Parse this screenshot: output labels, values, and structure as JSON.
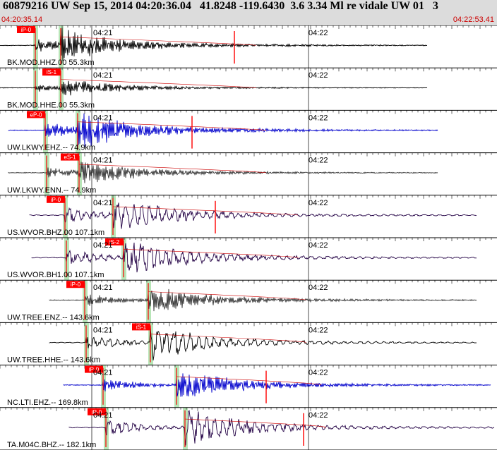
{
  "header": {
    "title": "60879216 UW Sep 15, 2014 04:20:36.04   41.8248 -119.6430  3.6 3.34 Ml re vidale UW 01   3",
    "start_time": "04:20:35.14",
    "end_time": "04:22:53.41"
  },
  "colors": {
    "header_bg": "#dcdcdc",
    "pick": "#ff0000",
    "phase_window": "#b8e6b8"
  },
  "ticks": [
    "04:21",
    "04:22"
  ],
  "traces": [
    {
      "label": "BK.MOD.HHZ.00 55.3km",
      "color": "#000000",
      "pick_label": "iP-0",
      "s_label": "",
      "end_label": ""
    },
    {
      "label": "BK.MOD.HHE.00 55.3km",
      "color": "#000000",
      "pick_label": "",
      "s_label": "iS-1",
      "end_label": ""
    },
    {
      "label": "UW.LKWY.EHZ.-- 74.9km",
      "color": "#0000cc",
      "pick_label": "eP-0",
      "s_label": "",
      "end_label": ""
    },
    {
      "label": "UW.LKWY.ENN.-- 74.9km",
      "color": "#333333",
      "pick_label": "",
      "s_label": "eS-1",
      "end_label": ""
    },
    {
      "label": "US.WVOR.BHZ.00 107.1km",
      "color": "#220044",
      "pick_label": "iP-0",
      "s_label": "",
      "end_label": ""
    },
    {
      "label": "US.WVOR.BH1.00 107.1km",
      "color": "#220044",
      "pick_label": "",
      "s_label": "iS-2",
      "end_label": ""
    },
    {
      "label": "UW.TREE.ENZ.-- 143.6km",
      "color": "#333333",
      "pick_label": "iP-0",
      "s_label": "",
      "end_label": ""
    },
    {
      "label": "UW.TREE.HHE.-- 143.6km",
      "color": "#000000",
      "pick_label": "",
      "s_label": "iS-1",
      "end_label": ""
    },
    {
      "label": "NC.LTI.EHZ.-- 169.8km",
      "color": "#0000cc",
      "pick_label": "iP-0",
      "s_label": "",
      "end_label": ""
    },
    {
      "label": "TA.M04C.BHZ.-- 182.1km",
      "color": "#220044",
      "pick_label": "iP-0",
      "s_label": "",
      "end_label": ""
    }
  ]
}
